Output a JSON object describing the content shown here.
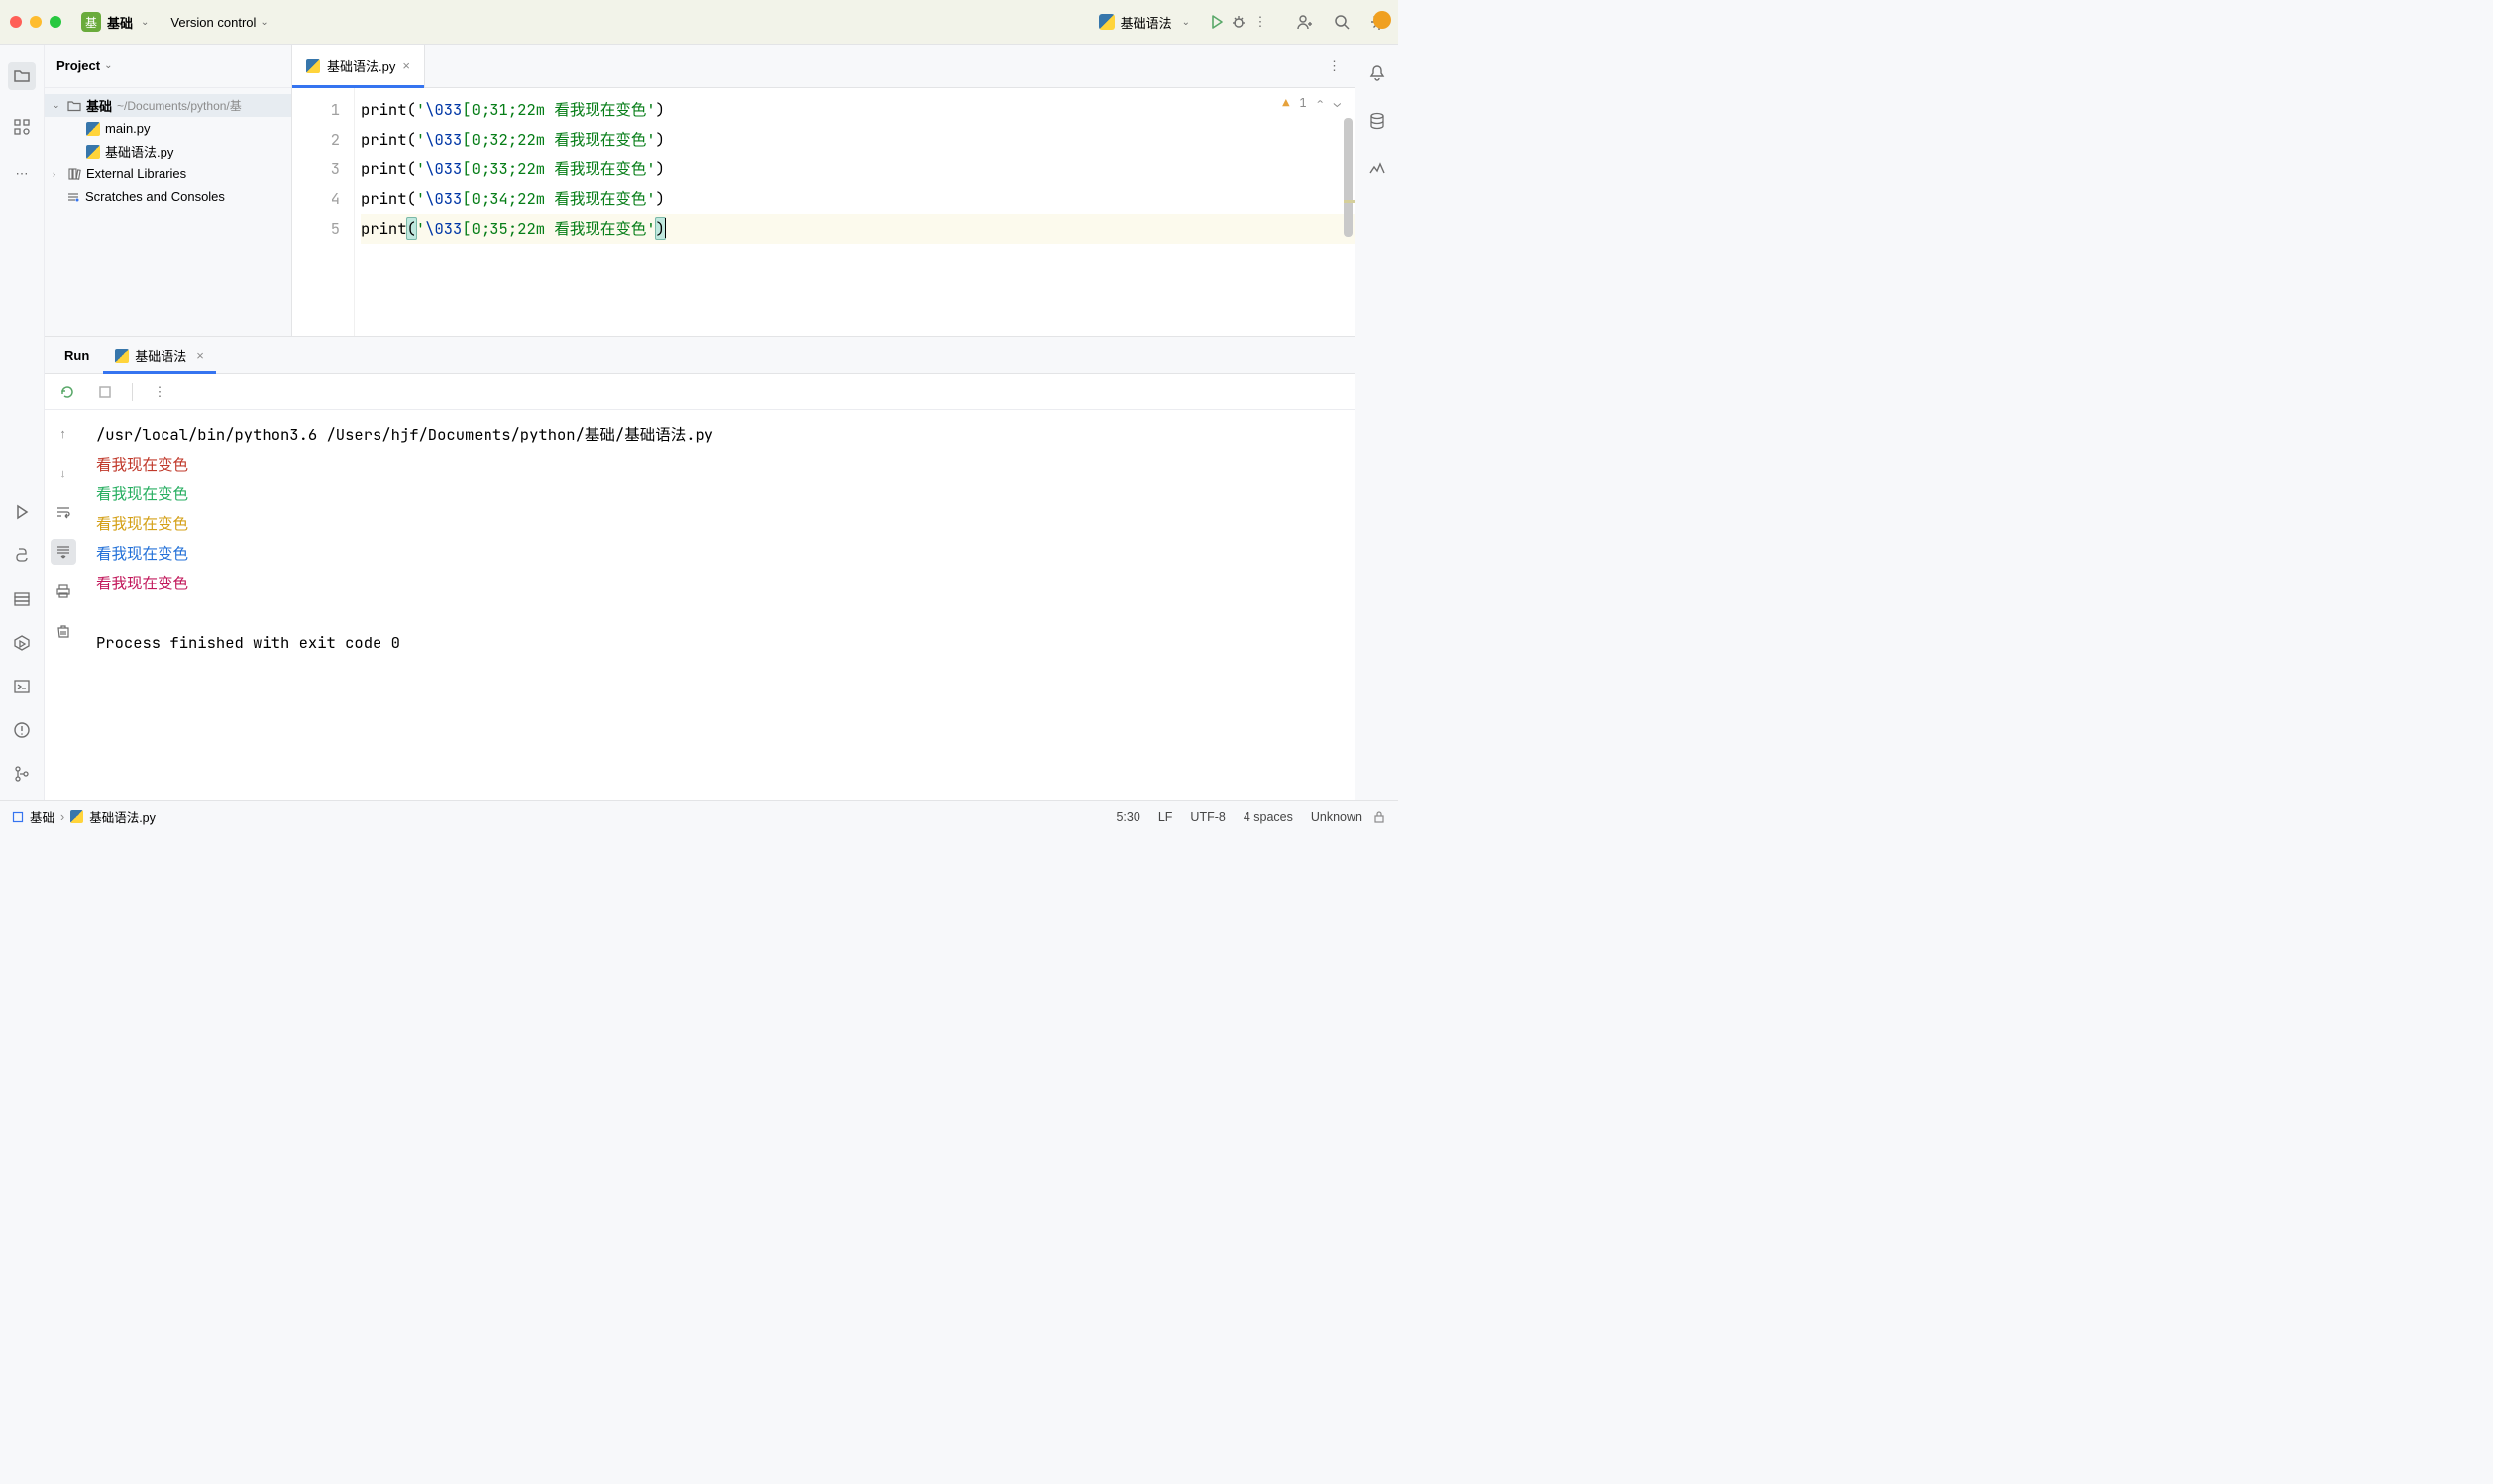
{
  "topbar": {
    "project_badge": "基",
    "project_name": "基础",
    "vcs_label": "Version control",
    "run_config_name": "基础语法"
  },
  "project_panel": {
    "title": "Project",
    "root_name": "基础",
    "root_path": "~/Documents/python/基",
    "files": [
      "main.py",
      "基础语法.py"
    ],
    "external_libs": "External Libraries",
    "scratches": "Scratches and Consoles"
  },
  "editor": {
    "tab_name": "基础语法.py",
    "warning_count": "1",
    "lines": [
      {
        "n": "1",
        "fn": "print",
        "open": "(",
        "s1": "'",
        "esc": "\\033",
        "s2": "[0;31;22m 看我现在变色'",
        "close": ")"
      },
      {
        "n": "2",
        "fn": "print",
        "open": "(",
        "s1": "'",
        "esc": "\\033",
        "s2": "[0;32;22m 看我现在变色'",
        "close": ")"
      },
      {
        "n": "3",
        "fn": "print",
        "open": "(",
        "s1": "'",
        "esc": "\\033",
        "s2": "[0;33;22m 看我现在变色'",
        "close": ")"
      },
      {
        "n": "4",
        "fn": "print",
        "open": "(",
        "s1": "'",
        "esc": "\\033",
        "s2": "[0;34;22m 看我现在变色'",
        "close": ")"
      },
      {
        "n": "5",
        "fn": "print",
        "open": "(",
        "s1": "'",
        "esc": "\\033",
        "s2": "[0;35;22m 看我现在变色'",
        "close": ")"
      }
    ]
  },
  "run": {
    "tab_label": "Run",
    "config_name": "基础语法",
    "command": "/usr/local/bin/python3.6 /Users/hjf/Documents/python/基础/基础语法.py",
    "outputs": [
      {
        "text": " 看我现在变色",
        "cls": "c-red"
      },
      {
        "text": " 看我现在变色",
        "cls": "c-green"
      },
      {
        "text": " 看我现在变色",
        "cls": "c-yellow"
      },
      {
        "text": " 看我现在变色",
        "cls": "c-blue"
      },
      {
        "text": " 看我现在变色",
        "cls": "c-magenta"
      }
    ],
    "exit_line": "Process finished with exit code 0"
  },
  "status": {
    "breadcrumb_root": "基础",
    "breadcrumb_file": "基础语法.py",
    "cursor": "5:30",
    "line_sep": "LF",
    "encoding": "UTF-8",
    "indent": "4 spaces",
    "interpreter": "Unknown"
  },
  "colors": {
    "accent": "#3574f0"
  }
}
